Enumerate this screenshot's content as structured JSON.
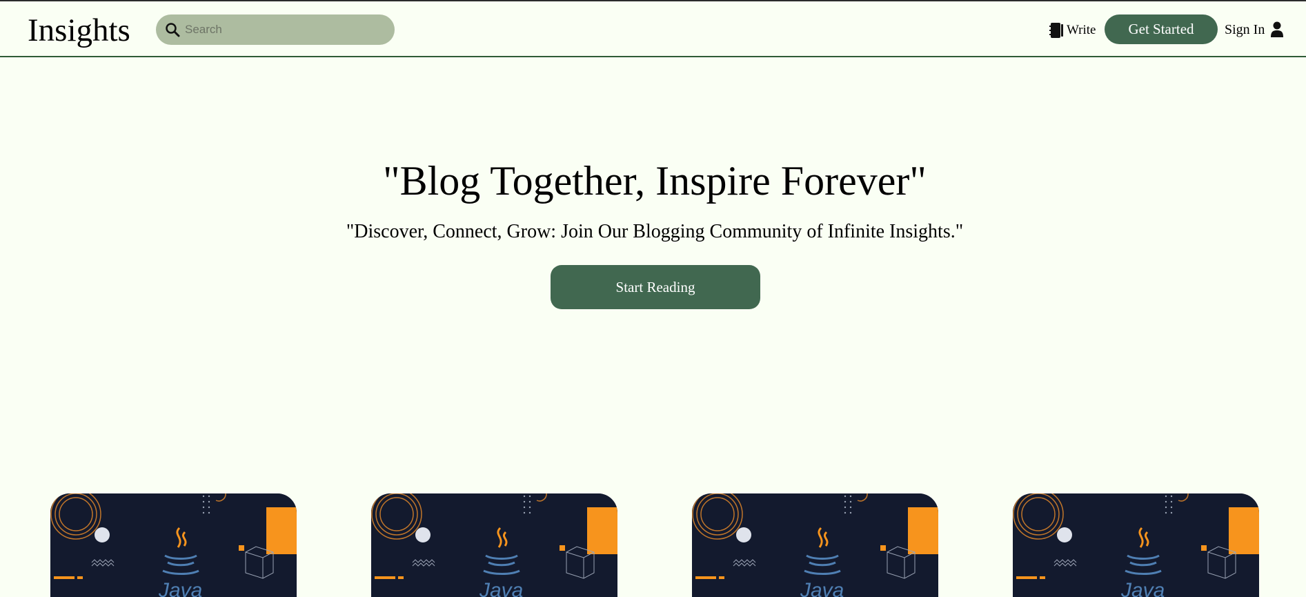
{
  "header": {
    "logo": "Insights",
    "search_placeholder": "Search",
    "write_label": "Write",
    "get_started_label": "Get Started",
    "signin_label": "Sign In"
  },
  "hero": {
    "title": "\"Blog Together, Inspire Forever\"",
    "subtitle": "\"Discover, Connect, Grow: Join Our Blogging Community of Infinite Insights.\"",
    "cta_label": "Start Reading"
  },
  "cards": [
    {
      "image": "java-thumbnail"
    },
    {
      "image": "java-thumbnail"
    },
    {
      "image": "java-thumbnail"
    },
    {
      "image": "java-thumbnail"
    }
  ],
  "colors": {
    "background": "#fafff4",
    "accent": "#416850",
    "search_bg": "#adbca0",
    "card_bg": "#131a2e",
    "card_orange": "#f7941d",
    "java_blue": "#4f7fb3"
  },
  "icons": {
    "search": "search-icon",
    "write": "notebook-icon",
    "signin": "user-icon"
  }
}
